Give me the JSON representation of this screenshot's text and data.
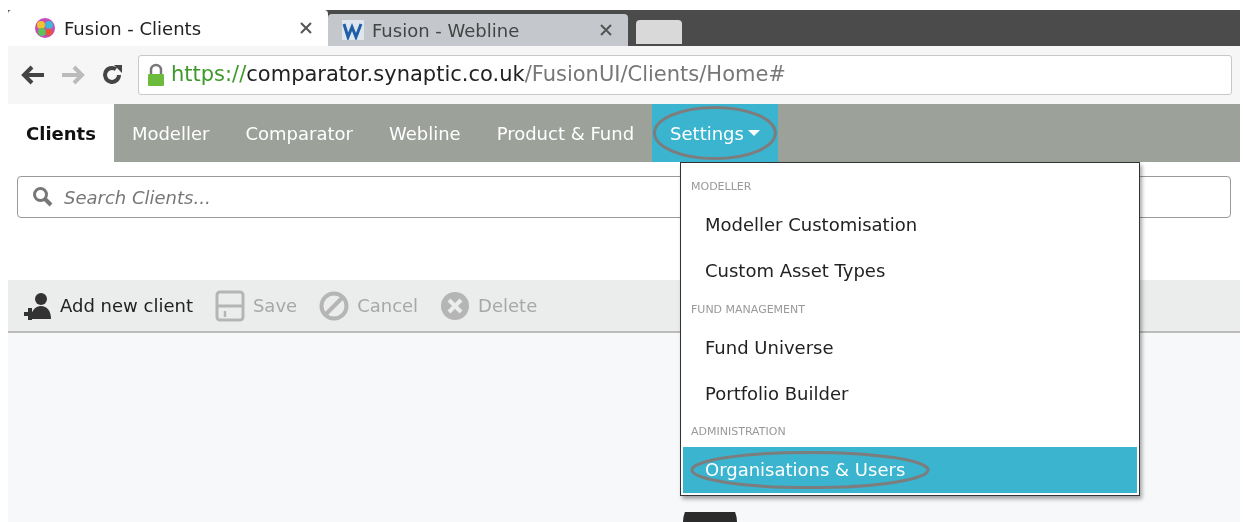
{
  "browser_tabs": [
    {
      "title": "Fusion - Clients",
      "selected": true
    },
    {
      "title": "Fusion - Webline",
      "selected": false
    }
  ],
  "address_bar": {
    "scheme": "https://",
    "host": "comparator.synaptic.co.uk",
    "path": "/FusionUI/Clients/Home#"
  },
  "nav_tabs": [
    {
      "label": "Clients",
      "selected": true,
      "dropdown": false,
      "annotated": false
    },
    {
      "label": "Modeller",
      "selected": false,
      "dropdown": false,
      "annotated": false
    },
    {
      "label": "Comparator",
      "selected": false,
      "dropdown": false,
      "annotated": false
    },
    {
      "label": "Webline",
      "selected": false,
      "dropdown": false,
      "annotated": false
    },
    {
      "label": "Product & Fund",
      "selected": false,
      "dropdown": false,
      "annotated": false
    },
    {
      "label": "Settings",
      "selected": false,
      "dropdown": true,
      "annotated": true
    }
  ],
  "search": {
    "placeholder": "Search Clients..."
  },
  "toolbar": [
    {
      "label": "Add new client",
      "disabled": false
    },
    {
      "label": "Save",
      "disabled": true
    },
    {
      "label": "Cancel",
      "disabled": true
    },
    {
      "label": "Delete",
      "disabled": true
    }
  ],
  "settings_menu": [
    {
      "kind": "header",
      "label": "MODELLER"
    },
    {
      "kind": "item",
      "label": "Modeller Customisation",
      "selected": false,
      "annotated": false
    },
    {
      "kind": "item",
      "label": "Custom Asset Types",
      "selected": false,
      "annotated": false
    },
    {
      "kind": "header",
      "label": "FUND MANAGEMENT"
    },
    {
      "kind": "item",
      "label": "Fund Universe",
      "selected": false,
      "annotated": false
    },
    {
      "kind": "item",
      "label": "Portfolio Builder",
      "selected": false,
      "annotated": false
    },
    {
      "kind": "header",
      "label": "ADMINISTRATION"
    },
    {
      "kind": "item",
      "label": "Organisations & Users",
      "selected": true,
      "annotated": true
    }
  ]
}
